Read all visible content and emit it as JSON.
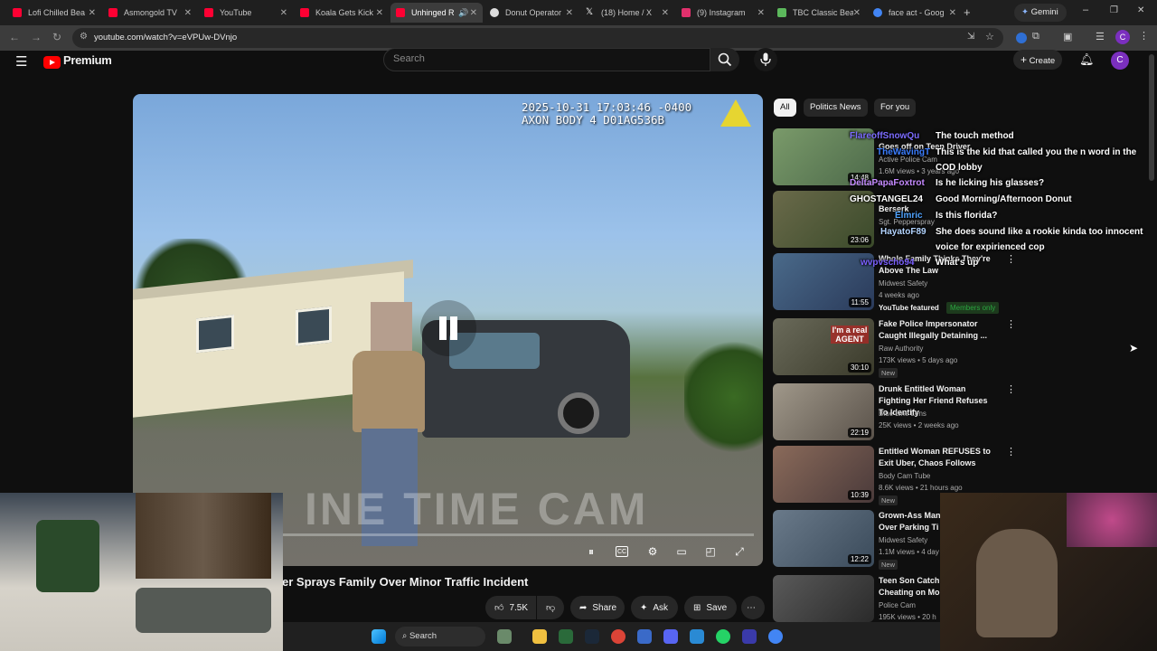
{
  "browser": {
    "tabs": [
      {
        "label": "Lofi Chilled Bea",
        "color": "#ff0033"
      },
      {
        "label": "Asmongold TV",
        "color": "#ff0033"
      },
      {
        "label": "YouTube",
        "color": "#ff0033"
      },
      {
        "label": "Koala Gets Kick",
        "color": "#ff0033"
      },
      {
        "label": "Unhinged R",
        "color": "#ff0033"
      },
      {
        "label": "Donut Operator",
        "color": "#dddddd"
      },
      {
        "label": "(18) Home / X",
        "color": "#ffffff"
      },
      {
        "label": "(9) Instagram",
        "color": "#e1306c"
      },
      {
        "label": "TBC Classic Bea",
        "color": "#5cb85c"
      },
      {
        "label": "face act - Goog",
        "color": "#4285f4"
      }
    ],
    "gemini_label": "Gemini",
    "url": "youtube.com/watch?v=eVPUw-DVnjo",
    "profile_initial": "C"
  },
  "youtube": {
    "logo_text": "Premium",
    "search_placeholder": "Search",
    "create_label": "Create",
    "avatar_initial": "C",
    "video": {
      "timestamp_line1": "2025-10-31 17:03:46 -0400",
      "timestamp_line2": "AXON BODY 4 D01AG536B",
      "watermark": "INE TIME CAM",
      "progress": 0.01
    },
    "video_title": "er Sprays Family Over Minor Traffic Incident",
    "actions": {
      "likes": "7.5K",
      "share": "Share",
      "ask": "Ask",
      "save": "Save"
    },
    "chips": [
      "All",
      "Politics News",
      "For you"
    ],
    "recommendations": [
      {
        "title": "Goes off on Teen Driver",
        "channel": "Active Police Cam",
        "meta": "1.6M views • 3 years ago",
        "duration": "14:48",
        "thumb": "#5e7f5a"
      },
      {
        "title": "Berserk",
        "channel": "Sgt. Pepperspray",
        "meta": "",
        "duration": "23:06",
        "thumb": "#4e5a3b"
      },
      {
        "title": "Whole Family Thinks They're Above The Law",
        "channel": "Midwest Safety",
        "meta": "4 weeks ago",
        "badge1": "YouTube featured",
        "badge2": "Members only",
        "duration": "11:55",
        "thumb": "#3d5d7e"
      },
      {
        "title": "Fake Police Impersonator Caught Illegally Detaining ...",
        "channel": "Raw Authority",
        "meta": "173K views • 5 days ago",
        "newb": "New",
        "duration": "30:10",
        "thumb": "#5b5c4d",
        "overlay": "I'm a real AGENT"
      },
      {
        "title": "Drunk Entitled Woman Fighting Her Friend Refuses To Identify",
        "channel": "Blue Line Lens",
        "meta": "25K views • 2 weeks ago",
        "duration": "22:19",
        "thumb": "#8c8578"
      },
      {
        "title": "Entitled Woman REFUSES to Exit Uber, Chaos Follows",
        "channel": "Body Cam Tube",
        "meta": "8.6K views • 21 hours ago",
        "newb": "New",
        "duration": "10:39",
        "thumb": "#6f5c52"
      },
      {
        "title": "Grown-Ass Man Over Parking Ti",
        "channel": "Midwest Safety",
        "meta": "1.1M views • 4 day",
        "newb": "New",
        "duration": "12:22",
        "thumb": "#55606a"
      },
      {
        "title": "Teen Son Catch Cheating on Mo",
        "channel": "Police Cam",
        "meta": "195K views • 20 h",
        "duration": "14:50",
        "thumb": "#4a4a4a"
      }
    ]
  },
  "chat": [
    {
      "user": "FlareoffSnowQu",
      "msg": "The touch method",
      "color": "#7c6cff"
    },
    {
      "user": "TheWavingT",
      "msg": "This is the kid that called you the n word in the COD lobby",
      "color": "#3b7dff"
    },
    {
      "user": "DeltaPapaFoxtrot",
      "msg": "Is he licking his glasses?",
      "color": "#c58aff"
    },
    {
      "user": "GHOSTANGEL24",
      "msg": "Good Morning/Afternoon Donut",
      "color": "#ffffff"
    },
    {
      "user": "Elmric",
      "msg": "Is this florida?",
      "color": "#4fa3ff"
    },
    {
      "user": "HayatoF89",
      "msg": "She does sound like a rookie kinda too innocent voice for expirienced cop",
      "color": "#b3d4ff"
    },
    {
      "user": "wvpvscho94",
      "msg": "What's up",
      "color": "#7b61ff"
    }
  ],
  "taskbar": {
    "search_label": "Search"
  }
}
